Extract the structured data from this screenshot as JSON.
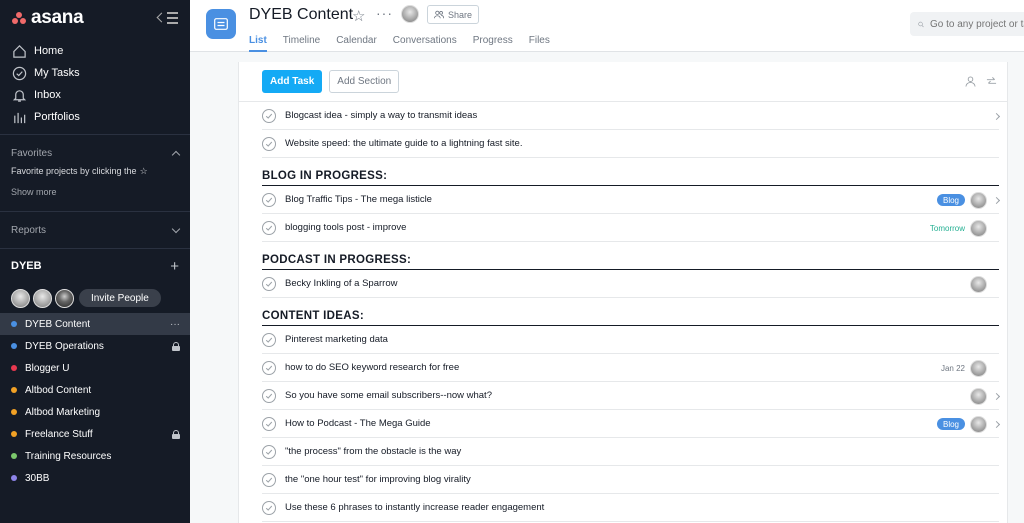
{
  "brand": {
    "name": "asana"
  },
  "sidebar": {
    "nav": [
      {
        "label": "Home",
        "icon": "home-icon"
      },
      {
        "label": "My Tasks",
        "icon": "check-circle-icon"
      },
      {
        "label": "Inbox",
        "icon": "bell-icon"
      },
      {
        "label": "Portfolios",
        "icon": "bar-chart-icon"
      }
    ],
    "favorites": {
      "title": "Favorites",
      "hint": "Favorite projects by clicking the",
      "show_more": "Show more"
    },
    "reports": {
      "title": "Reports"
    },
    "team": {
      "name": "DYEB",
      "invite_label": "Invite People",
      "projects": [
        {
          "label": "DYEB Content",
          "color": "#4a90e2",
          "active": true,
          "right": "more"
        },
        {
          "label": "DYEB Operations",
          "color": "#4a90e2",
          "right": "lock"
        },
        {
          "label": "Blogger U",
          "color": "#e8384f",
          "right": ""
        },
        {
          "label": "Altbod Content",
          "color": "#f1a125",
          "right": ""
        },
        {
          "label": "Altbod Marketing",
          "color": "#f1a125",
          "right": ""
        },
        {
          "label": "Freelance Stuff",
          "color": "#f1a125",
          "right": "lock"
        },
        {
          "label": "Training Resources",
          "color": "#7bc86c",
          "right": ""
        },
        {
          "label": "30BB",
          "color": "#8d84e8",
          "right": ""
        }
      ]
    }
  },
  "header": {
    "title": "DYEB Content",
    "share_label": "Share",
    "tabs": [
      "List",
      "Timeline",
      "Calendar",
      "Conversations",
      "Progress",
      "Files"
    ],
    "active_tab": "List",
    "search_placeholder": "Go to any project or task"
  },
  "toolbar": {
    "add_task": "Add Task",
    "add_section": "Add Section"
  },
  "list": {
    "top_tasks": [
      {
        "name": "Blogcast idea - simply a way to transmit ideas",
        "chevron": true
      },
      {
        "name": "Website speed: the ultimate guide to a lightning fast site."
      }
    ],
    "sections": [
      {
        "title": "BLOG IN PROGRESS:",
        "tasks": [
          {
            "name": "Blog Traffic Tips - The mega listicle",
            "tag": "Blog",
            "avatar": true,
            "chevron": true
          },
          {
            "name": "blogging tools post - improve",
            "due": "Tomorrow",
            "due_color": "green",
            "avatar": true
          }
        ]
      },
      {
        "title": "PODCAST IN PROGRESS:",
        "tasks": [
          {
            "name": "Becky Inkling of a Sparrow",
            "avatar": true
          }
        ]
      },
      {
        "title": "CONTENT IDEAS:",
        "tasks": [
          {
            "name": "Pinterest marketing data"
          },
          {
            "name": "how to do SEO keyword research for free",
            "due": "Jan 22",
            "avatar": true
          },
          {
            "name": "So you have some email subscribers--now what?",
            "avatar": true,
            "chevron": true
          },
          {
            "name": "How to Podcast - The Mega Guide",
            "tag": "Blog",
            "avatar": true,
            "chevron": true
          },
          {
            "name": "\"the process\" from the obstacle is the way"
          },
          {
            "name": "the \"one hour test\" for improving blog virality"
          },
          {
            "name": "Use these 6 phrases to instantly increase reader engagement"
          }
        ]
      }
    ]
  }
}
